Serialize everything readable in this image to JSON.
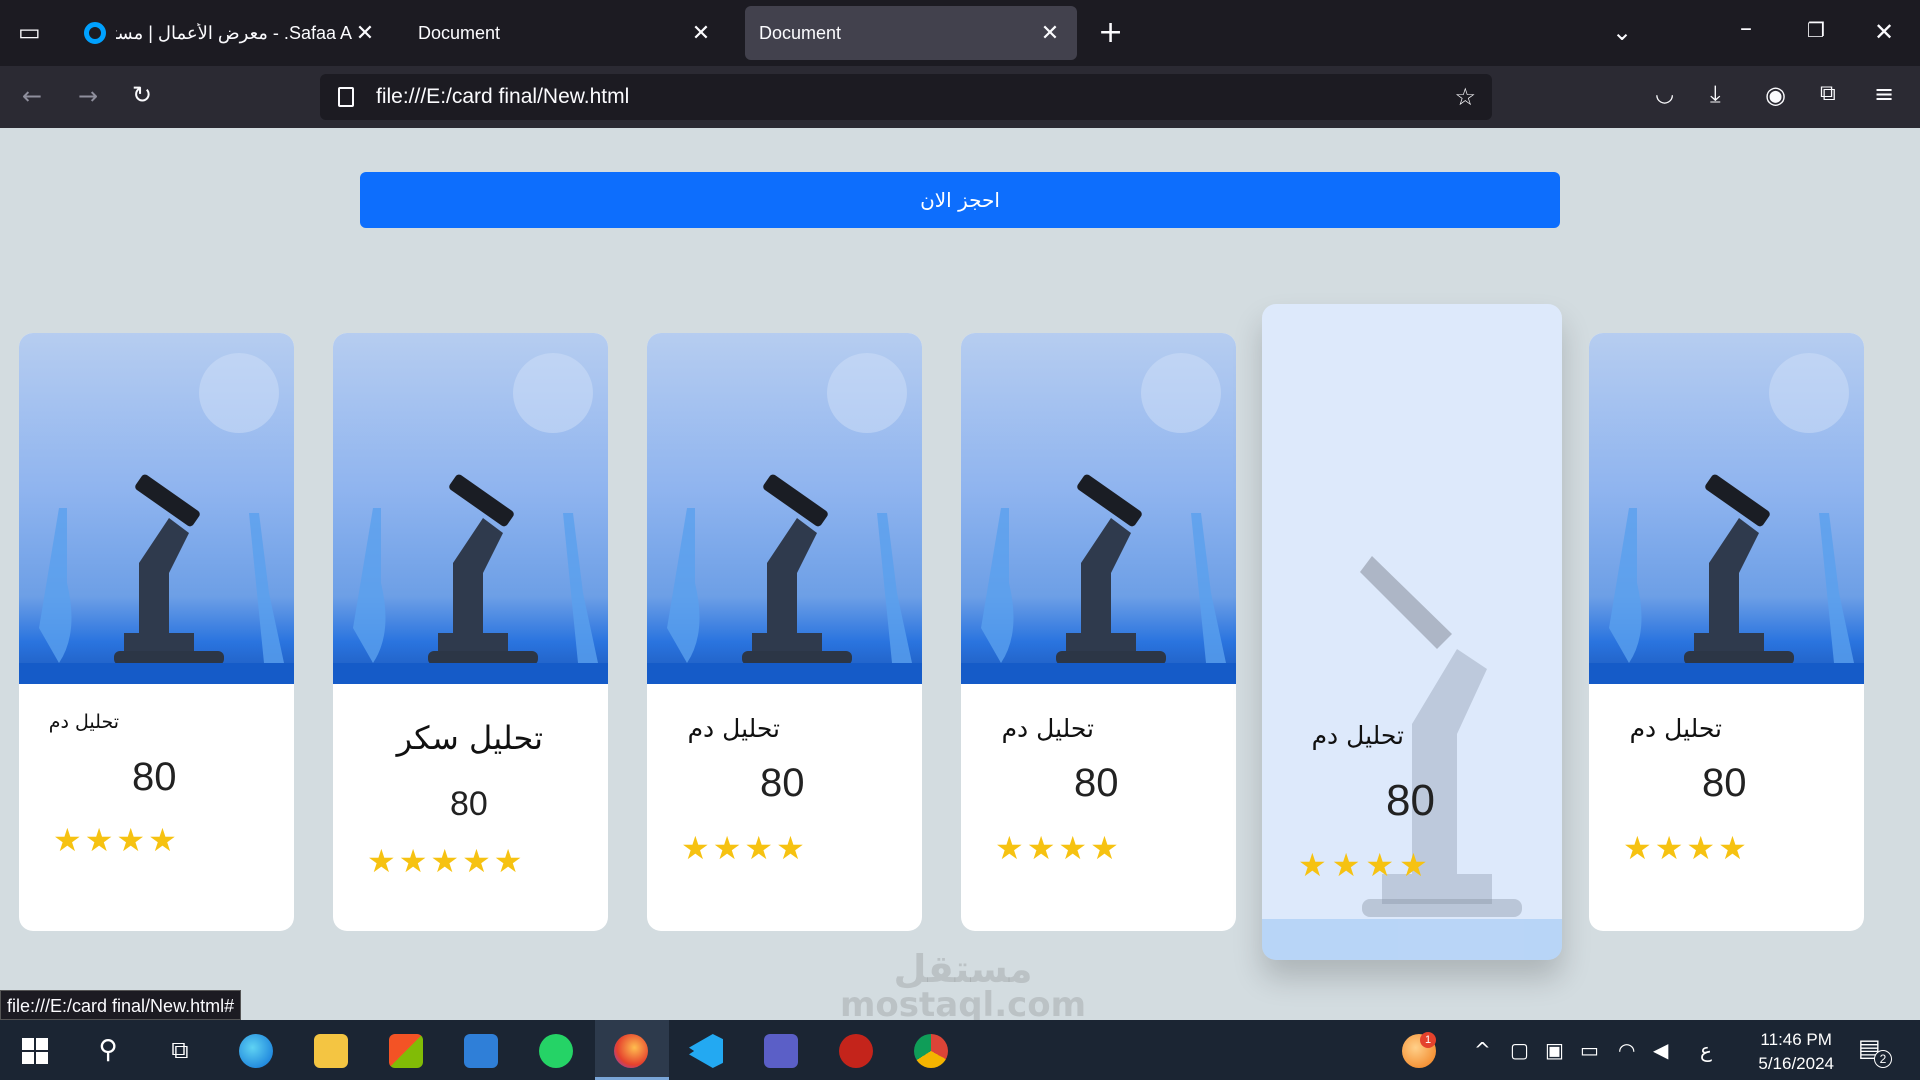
{
  "browser": {
    "tabs": [
      {
        "title": "Safaa A. - معرض الأعمال | مستقل",
        "active": false
      },
      {
        "title": "Document",
        "active": false
      },
      {
        "title": "Document",
        "active": true
      }
    ],
    "new_tab": "+",
    "url": "file:///E:/card final/New.html",
    "status_url": "file:///E:/card final/New.html#"
  },
  "page": {
    "book_button": "احجز الان",
    "cards": [
      {
        "name": "تحليل دم",
        "price": "80",
        "stars": "★★★★"
      },
      {
        "name": "تحليل سكر",
        "price": "80",
        "stars": "★★★★★"
      },
      {
        "name": "تحليل دم",
        "price": "80",
        "stars": "★★★★"
      },
      {
        "name": "تحليل دم",
        "price": "80",
        "stars": "★★★★"
      },
      {
        "name": "تحليل دم",
        "price": "80",
        "stars": "★★★★"
      },
      {
        "name": "تحليل دم",
        "price": "80",
        "stars": "★★★★"
      }
    ],
    "watermark": "mostaql.com",
    "watermark_ar": "مستقل"
  },
  "taskbar": {
    "time": "11:46 PM",
    "date": "5/16/2024",
    "input_lang": "ع",
    "notif_count": "2",
    "badge_count": "1"
  },
  "colors": {
    "accent": "#0d6efd",
    "star": "#f6c211",
    "page_bg": "#d3dce0"
  }
}
